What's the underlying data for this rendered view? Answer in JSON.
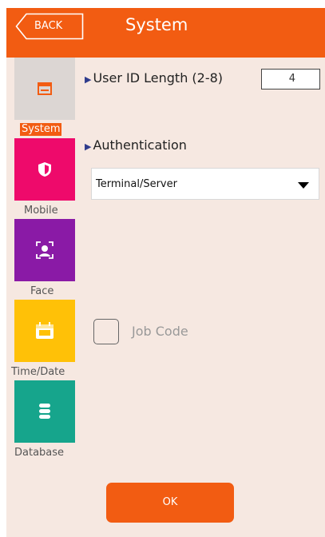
{
  "header": {
    "back_label": "BACK",
    "title": "System"
  },
  "sidebar": {
    "items": [
      {
        "label": "System",
        "icon": "window-icon",
        "color": "#dcd6d3",
        "selected": true
      },
      {
        "label": "Mobile",
        "icon": "shield-icon",
        "color": "#ee0a6b",
        "selected": false
      },
      {
        "label": "Face",
        "icon": "face-scan-icon",
        "color": "#8a1aa6",
        "selected": false
      },
      {
        "label": "Time/Date",
        "icon": "calendar-day-icon",
        "color": "#ffc107",
        "selected": false
      },
      {
        "label": "Database",
        "icon": "database-icon",
        "color": "#16a58c",
        "selected": false
      }
    ]
  },
  "main": {
    "user_id_length_label": "User ID Length (2-8)",
    "user_id_length_value": "4",
    "authentication_label": "Authentication",
    "authentication_value": "Terminal/Server",
    "job_code_label": "Job Code",
    "job_code_checked": false
  },
  "footer": {
    "ok_label": "OK"
  },
  "colors": {
    "accent": "#f25c12",
    "background": "#f6e8e1",
    "marker": "#2f3c8c"
  }
}
